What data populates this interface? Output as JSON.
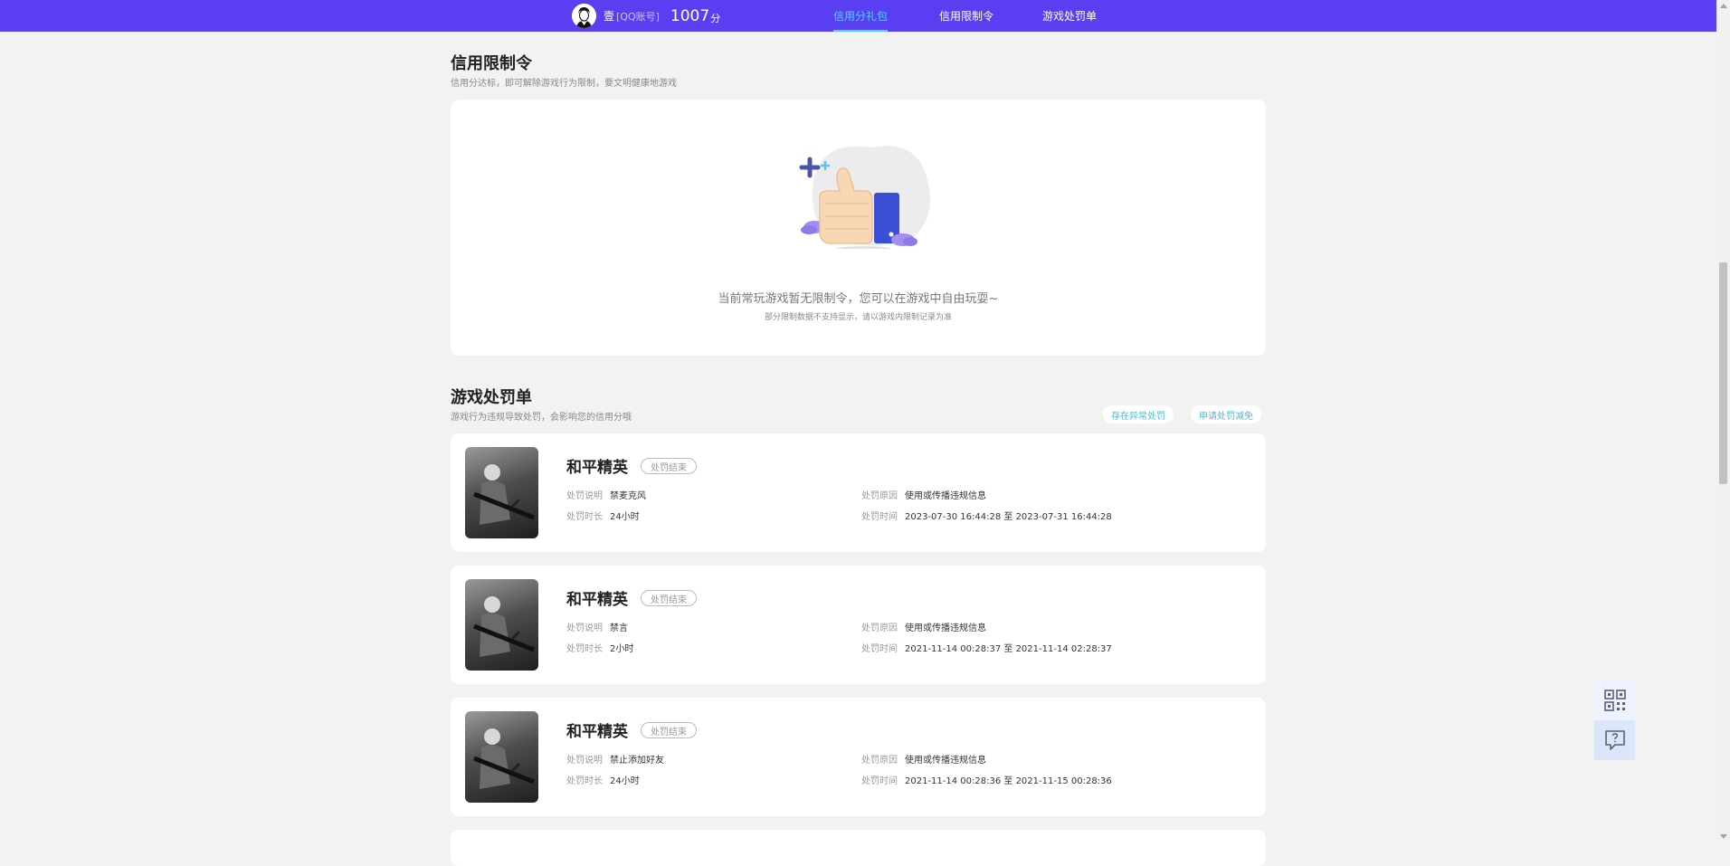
{
  "topbar": {
    "user_name": "壹",
    "account_type": "[QQ账号]",
    "score": "1007",
    "score_unit": "分",
    "tabs": [
      {
        "label": "信用分礼包",
        "active": true
      },
      {
        "label": "信用限制令",
        "active": false
      },
      {
        "label": "游戏处罚单",
        "active": false
      }
    ]
  },
  "restriction": {
    "title": "信用限制令",
    "subtitle": "信用分达标，即可解除游戏行为限制，要文明健康地游戏",
    "empty_text": "当前常玩游戏暂无限制令，您可以在游戏中自由玩耍~",
    "empty_note": "部分限制数据不支持显示，请以游戏内限制记录为准"
  },
  "penalty": {
    "title": "游戏处罚单",
    "subtitle": "游戏行为违规导致处罚，会影响您的信用分哦",
    "btn_abnormal": "存在异常处罚",
    "btn_reduce": "申请处罚减免",
    "labels": {
      "desc": "处罚说明",
      "duration": "处罚时长",
      "reason": "处罚原因",
      "time": "处罚时间"
    },
    "records": [
      {
        "game": "和平精英",
        "status": "处罚结束",
        "desc": "禁麦克风",
        "duration": "24小时",
        "reason": "使用或传播违规信息",
        "time": "2023-07-30 16:44:28 至 2023-07-31 16:44:28"
      },
      {
        "game": "和平精英",
        "status": "处罚结束",
        "desc": "禁言",
        "duration": "2小时",
        "reason": "使用或传播违规信息",
        "time": "2021-11-14 00:28:37 至 2021-11-14 02:28:37"
      },
      {
        "game": "和平精英",
        "status": "处罚结束",
        "desc": "禁止添加好友",
        "duration": "24小时",
        "reason": "使用或传播违规信息",
        "time": "2021-11-14 00:28:36 至 2021-11-15 00:28:36"
      }
    ]
  },
  "colors": {
    "topbar": "#5a3ff2",
    "active_tab": "#48d7ff",
    "link": "#4fb8d9"
  },
  "icons": {
    "qrcode": "qrcode-icon",
    "feedback": "feedback-icon"
  }
}
